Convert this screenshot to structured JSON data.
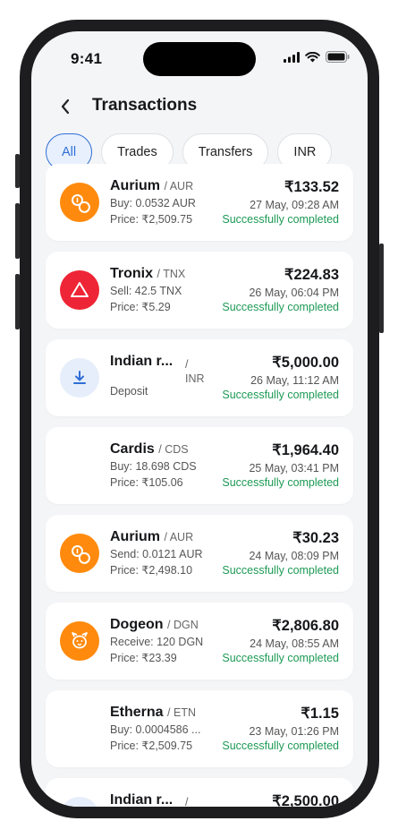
{
  "status_bar": {
    "time": "9:41"
  },
  "header": {
    "title": "Transactions"
  },
  "filters": [
    "All",
    "Trades",
    "Transfers",
    "INR"
  ],
  "colors": {
    "accent": "#2f6fd6",
    "success": "#1d9a55",
    "orange": "#ff8a0d",
    "red": "#ee2536"
  },
  "transactions": [
    {
      "icon": "coins-icon",
      "name": "Aurium",
      "sym": "/ AUR",
      "line1": "Buy: 0.0532 AUR",
      "line2": "Price: ₹2,509.75",
      "amount": "₹133.52",
      "date": "27 May, 09:28 AM",
      "status": "Successfully completed"
    },
    {
      "icon": "triangle-icon",
      "name": "Tronix",
      "sym": "/ TNX",
      "line1": "Sell: 42.5 TNX",
      "line2": "Price: ₹5.29",
      "amount": "₹224.83",
      "date": "26 May, 06:04 PM",
      "status": "Successfully completed"
    },
    {
      "icon": "download-icon",
      "name": "Indian r...",
      "sym": "/ INR",
      "line1": "",
      "line2": "Deposit",
      "amount": "₹5,000.00",
      "date": "26 May, 11:12 AM",
      "status": "Successfully completed"
    },
    {
      "icon": "",
      "name": "Cardis",
      "sym": "/ CDS",
      "line1": "Buy: 18.698 CDS",
      "line2": "Price: ₹105.06",
      "amount": "₹1,964.40",
      "date": "25 May, 03:41 PM",
      "status": "Successfully completed"
    },
    {
      "icon": "coins-icon",
      "name": "Aurium",
      "sym": "/ AUR",
      "line1": "Send: 0.0121 AUR",
      "line2": "Price: ₹2,498.10",
      "amount": "₹30.23",
      "date": "24 May, 08:09 PM",
      "status": "Successfully completed"
    },
    {
      "icon": "dog-icon",
      "name": "Dogeon",
      "sym": "/ DGN",
      "line1": "Receive: 120 DGN",
      "line2": "Price: ₹23.39",
      "amount": "₹2,806.80",
      "date": "24 May, 08:55 AM",
      "status": "Successfully completed"
    },
    {
      "icon": "",
      "name": "Etherna",
      "sym": "/ ETN",
      "line1": "Buy: 0.0004586 ...",
      "line2": "Price: ₹2,509.75",
      "amount": "₹1.15",
      "date": "23 May, 01:26 PM",
      "status": "Successfully completed"
    },
    {
      "icon": "download-icon",
      "name": "Indian r...",
      "sym": "/",
      "line1": "",
      "line2": "",
      "amount": "₹2,500.00",
      "date": "",
      "status": ""
    }
  ]
}
